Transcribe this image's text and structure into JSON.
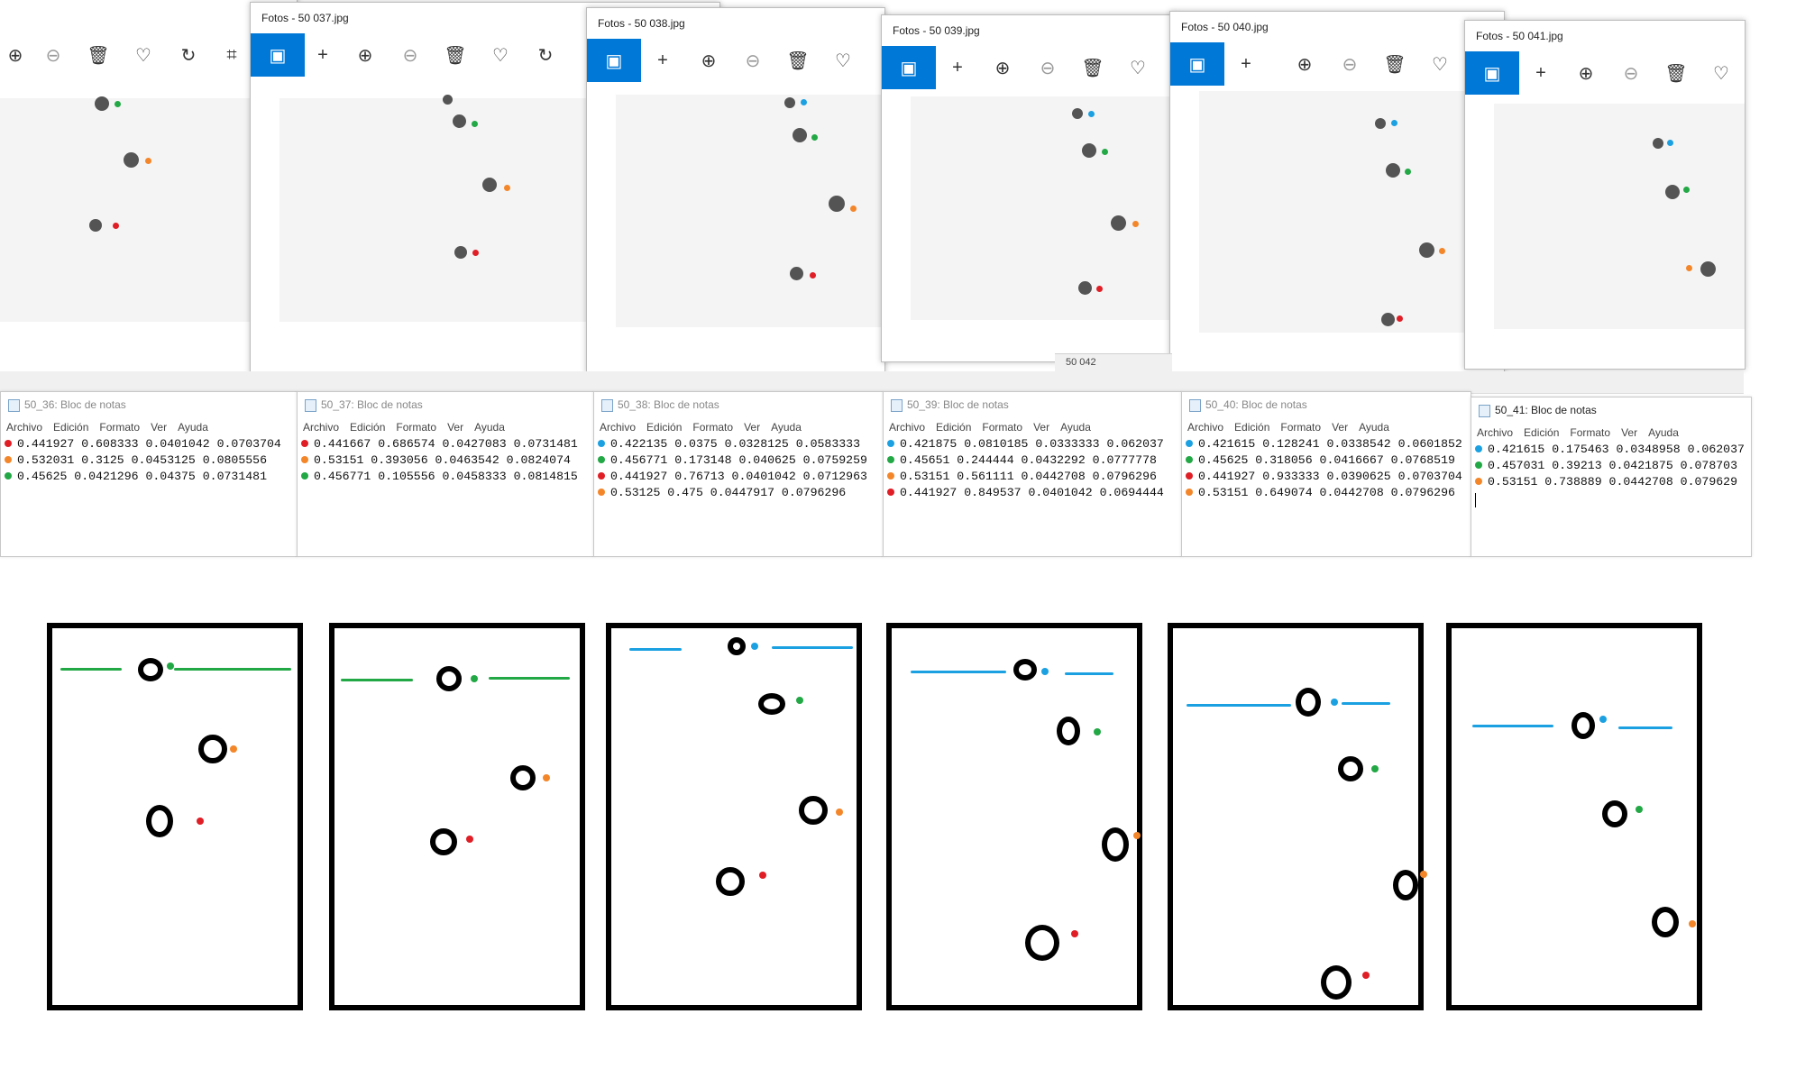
{
  "colors": {
    "accent": "#0078d7",
    "green": "#22a845",
    "orange": "#f4862a",
    "red": "#e01e26",
    "blue": "#1ba1e2"
  },
  "photo_windows": [
    {
      "title": "",
      "toolbar_icons": [
        "zoom-in-icon",
        "zoom-out-icon",
        "delete-icon",
        "heart-icon",
        "rotate-icon",
        "crop-icon"
      ]
    },
    {
      "title": "Fotos - 50 037.jpg",
      "toolbar_icons": [
        "image-icon",
        "add-icon",
        "zoom-in-icon",
        "zoom-out-icon",
        "delete-icon",
        "heart-icon",
        "rotate-icon"
      ]
    },
    {
      "title": "Fotos - 50 038.jpg",
      "toolbar_icons": [
        "image-icon",
        "add-icon",
        "zoom-in-icon",
        "zoom-out-icon",
        "delete-icon",
        "heart-icon"
      ]
    },
    {
      "title": "Fotos - 50 039.jpg",
      "toolbar_icons": [
        "image-icon",
        "add-icon",
        "zoom-in-icon",
        "zoom-out-icon",
        "delete-icon",
        "heart-icon"
      ]
    },
    {
      "title": "Fotos - 50 040.jpg",
      "toolbar_icons": [
        "image-icon",
        "add-icon",
        "zoom-in-icon",
        "zoom-out-icon",
        "delete-icon",
        "heart-icon"
      ]
    },
    {
      "title": "Fotos - 50 041.jpg",
      "toolbar_icons": [
        "image-icon",
        "add-icon",
        "zoom-in-icon",
        "zoom-out-icon",
        "delete-icon",
        "heart-icon"
      ]
    }
  ],
  "taskbar": {
    "label": "50 042"
  },
  "notepad_menu": [
    "Archivo",
    "Edición",
    "Formato",
    "Ver",
    "Ayuda"
  ],
  "notepads": [
    {
      "title": "50_36: Bloc de notas",
      "lines": [
        {
          "dot": "red",
          "text": "0.441927 0.608333 0.0401042 0.0703704"
        },
        {
          "dot": "orange",
          "text": "0.532031 0.3125 0.0453125 0.0805556"
        },
        {
          "dot": "green",
          "text": "0.45625 0.0421296 0.04375 0.0731481"
        }
      ]
    },
    {
      "title": "50_37: Bloc de notas",
      "lines": [
        {
          "dot": "red",
          "text": "0.441667 0.686574 0.0427083 0.0731481"
        },
        {
          "dot": "orange",
          "text": "0.53151 0.393056 0.0463542 0.0824074"
        },
        {
          "dot": "green",
          "text": "0.456771 0.105556 0.0458333 0.0814815"
        }
      ]
    },
    {
      "title": "50_38: Bloc de notas",
      "lines": [
        {
          "dot": "blue",
          "text": "0.422135 0.0375 0.0328125 0.0583333"
        },
        {
          "dot": "green",
          "text": "0.456771 0.173148 0.040625 0.0759259"
        },
        {
          "dot": "red",
          "text": "0.441927 0.76713 0.0401042 0.0712963"
        },
        {
          "dot": "orange",
          "text": "0.53125 0.475 0.0447917 0.0796296"
        }
      ]
    },
    {
      "title": "50_39: Bloc de notas",
      "lines": [
        {
          "dot": "blue",
          "text": "0.421875 0.0810185 0.0333333 0.062037"
        },
        {
          "dot": "green",
          "text": "0.45651 0.244444 0.0432292 0.0777778"
        },
        {
          "dot": "orange",
          "text": "0.53151 0.561111 0.0442708 0.0796296"
        },
        {
          "dot": "red",
          "text": "0.441927 0.849537 0.0401042 0.0694444"
        }
      ]
    },
    {
      "title": "50_40: Bloc de notas",
      "lines": [
        {
          "dot": "blue",
          "text": "0.421615 0.128241 0.0338542 0.0601852"
        },
        {
          "dot": "green",
          "text": "0.45625 0.318056 0.0416667 0.0768519"
        },
        {
          "dot": "red",
          "text": "0.441927 0.933333 0.0390625 0.0703704"
        },
        {
          "dot": "orange",
          "text": "0.53151 0.649074 0.0442708 0.0796296"
        }
      ]
    },
    {
      "title": "50_41: Bloc de notas",
      "lines": [
        {
          "dot": "blue",
          "text": "0.421615 0.175463 0.0348958 0.062037"
        },
        {
          "dot": "green",
          "text": "0.457031 0.39213 0.0421875 0.078703"
        },
        {
          "dot": "orange",
          "text": "0.53151 0.738889 0.0442708 0.079629"
        }
      ]
    }
  ]
}
